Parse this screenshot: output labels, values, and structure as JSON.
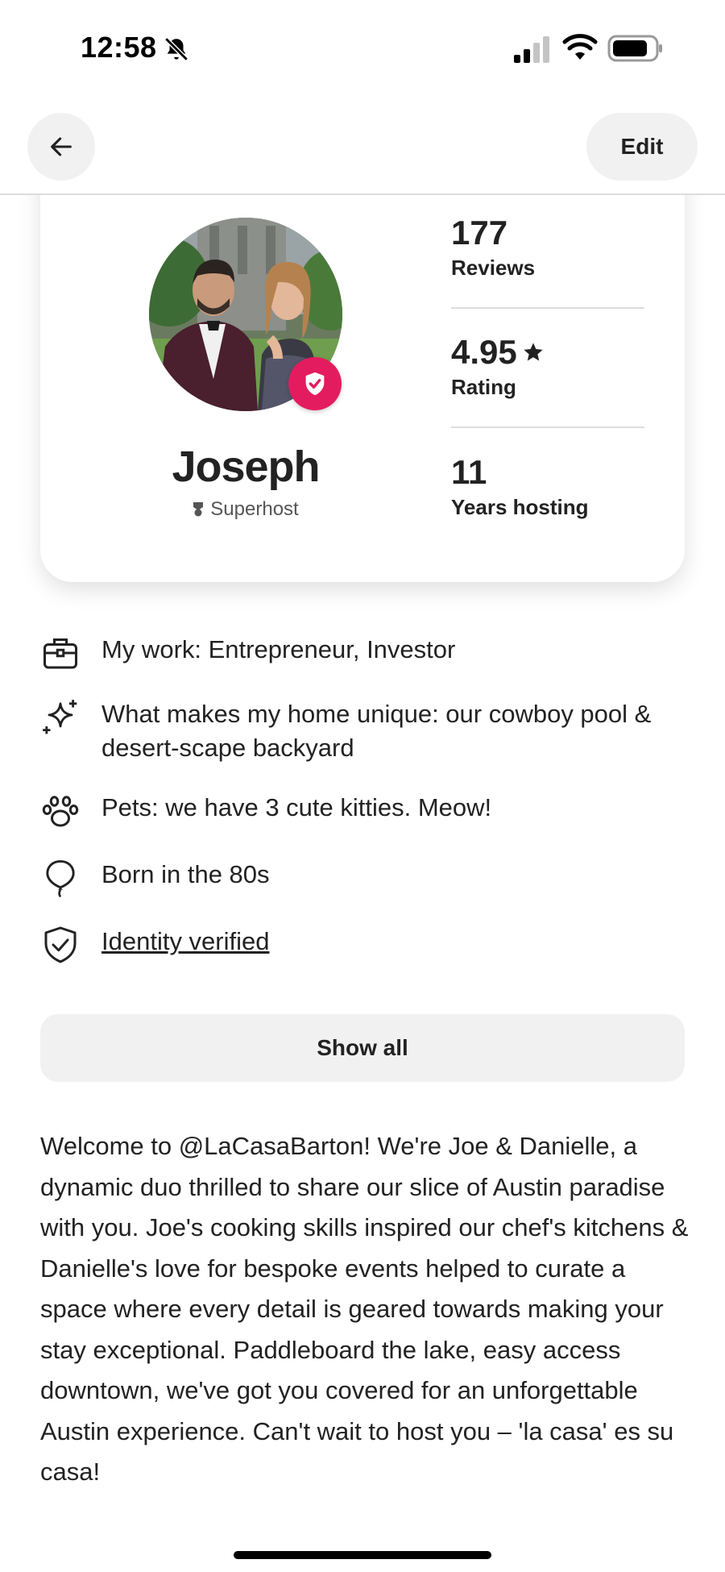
{
  "status_bar": {
    "time": "12:58",
    "icons": [
      "bell-off-icon",
      "signal-icon",
      "wifi-icon",
      "battery-icon"
    ]
  },
  "nav": {
    "back_icon": "arrow-left-icon",
    "edit_label": "Edit"
  },
  "profile": {
    "name": "Joseph",
    "badge": "Superhost",
    "verified_badge_icon": "shield-check-icon",
    "accent_color": "#e31c5f",
    "stats": [
      {
        "value": "177",
        "label": "Reviews"
      },
      {
        "value": "4.95",
        "label": "Rating",
        "icon": "star-icon"
      },
      {
        "value": "11",
        "label": "Years hosting"
      }
    ]
  },
  "info_items": [
    {
      "icon": "briefcase-icon",
      "text": "My work: Entrepreneur, Investor"
    },
    {
      "icon": "sparkles-icon",
      "text": "What makes my home unique: our cowboy pool & desert-scape backyard"
    },
    {
      "icon": "paw-icon",
      "text": "Pets: we have 3 cute kitties. Meow!"
    },
    {
      "icon": "balloon-icon",
      "text": "Born in the 80s"
    },
    {
      "icon": "shield-check-icon",
      "text": "Identity verified"
    }
  ],
  "show_all_label": "Show all",
  "bio": "Welcome to @LaCasaBarton! We're Joe & Danielle, a dynamic duo thrilled to share our slice of Austin paradise with you. Joe's cooking skills inspired our chef's kitchens & Danielle's love for bespoke events helped to curate a space where every detail is geared towards making your stay exceptional. Paddleboard the lake, easy access downtown, we've got you covered for an unforgettable Austin experience. Can't wait to host you – 'la casa' es su casa!"
}
